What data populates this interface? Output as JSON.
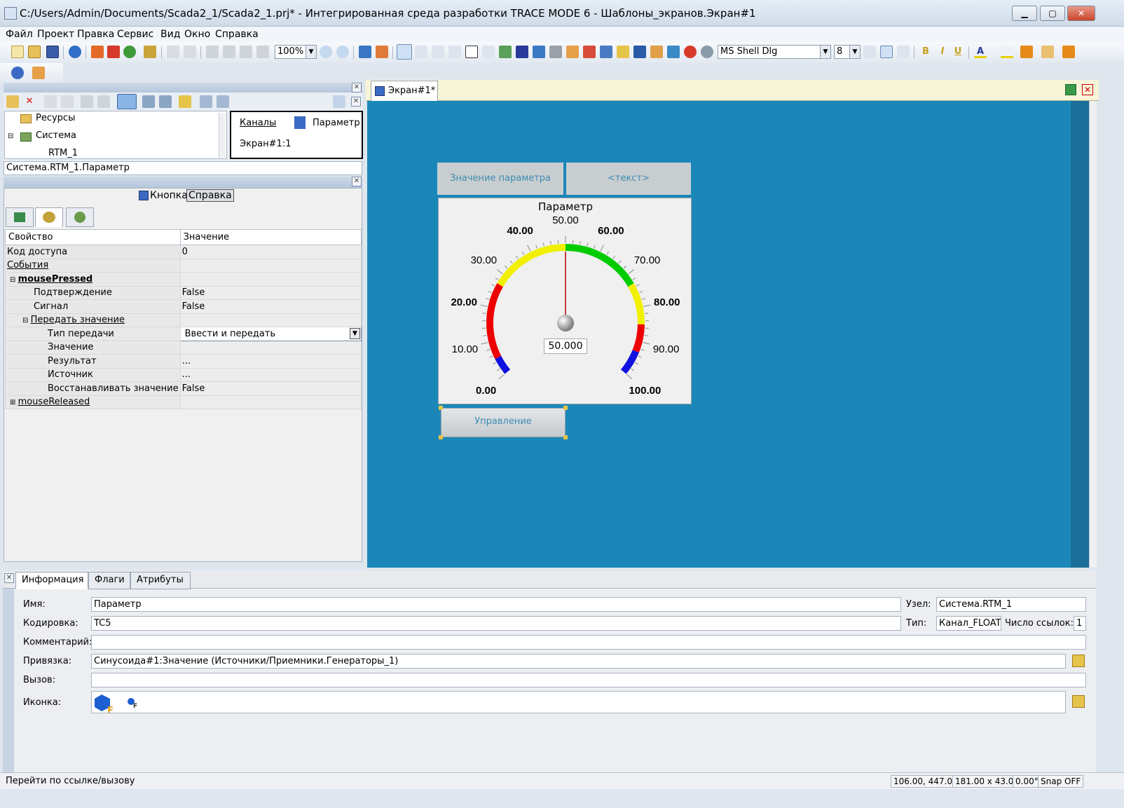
{
  "window": {
    "title": "C:/Users/Admin/Documents/Scada2_1/Scada2_1.prj* - Интегрированная среда разработки TRACE MODE 6 - Шаблоны_экранов.Экран#1",
    "min": "▁",
    "max": "▢",
    "close": "✕"
  },
  "menu": [
    "Файл",
    "Проект",
    "Правка",
    "Сервис",
    "Вид",
    "Окно",
    "Справка"
  ],
  "toolbar": {
    "zoom": "100%",
    "font_name": "MS Shell Dlg",
    "font_size": "8",
    "bold": "B",
    "italic": "I",
    "underline": "U",
    "text_color": "A"
  },
  "tree": {
    "items": [
      "Ресурсы",
      "Система",
      "RTM_1"
    ]
  },
  "channels": {
    "link": "Каналы",
    "param": "Параметр",
    "screen": "Экран#1:1"
  },
  "path": "Система.RTM_1.Параметр",
  "props": {
    "component_label": "Кнопка",
    "help_button": "Справка",
    "col_property": "Свойство",
    "col_value": "Значение",
    "rows": [
      {
        "k": "Код доступа",
        "v": "0"
      },
      {
        "k": "События",
        "v": ""
      },
      {
        "k": "mousePressed",
        "v": ""
      },
      {
        "k": "Подтверждение",
        "v": "False"
      },
      {
        "k": "Сигнал",
        "v": "False"
      },
      {
        "k": "Передать значение",
        "v": ""
      },
      {
        "k": "Тип передачи",
        "v": "Ввести и передать"
      },
      {
        "k": "Значение",
        "v": ""
      },
      {
        "k": "Результат",
        "v": "..."
      },
      {
        "k": "Источник",
        "v": "..."
      },
      {
        "k": "Восстанавливать значение",
        "v": "False"
      },
      {
        "k": "mouseReleased",
        "v": ""
      }
    ]
  },
  "editor": {
    "tab": "Экран#1*"
  },
  "screen": {
    "btn_param_value": "Значение параметра",
    "btn_text": "<текст>",
    "btn_control": "Управление",
    "gauge": {
      "title": "Параметр",
      "value": "50.000",
      "min": 0,
      "max": 100,
      "current": 50,
      "labels": [
        "0.00",
        "10.00",
        "20.00",
        "30.00",
        "40.00",
        "50.00",
        "60.00",
        "70.00",
        "80.00",
        "90.00",
        "100.00"
      ],
      "colors": {
        "blue": "#1010e0",
        "red": "#ee0000",
        "yellow": "#f0f000",
        "green": "#00cc00"
      }
    }
  },
  "info": {
    "tabs": [
      "Информация",
      "Флаги",
      "Атрибуты"
    ],
    "name_label": "Имя:",
    "name": "Параметр",
    "node_label": "Узел:",
    "node": "Система.RTM_1",
    "enc_label": "Кодировка:",
    "enc": "TC5",
    "type_label": "Тип:",
    "type": "Канал_FLOAT",
    "refs_label": "Число ссылок:",
    "refs": "1",
    "comment_label": "Комментарий:",
    "comment": "",
    "binding_label": "Привязка:",
    "binding": "Синусоида#1:Значение (Источники/Приемники.Генераторы_1)",
    "call_label": "Вызов:",
    "call": "",
    "icon_label": "Иконка:"
  },
  "status": {
    "hint": "Перейти по ссылке/вызову",
    "coords": "106.00, 447.00",
    "size": "181.00 x 43.00",
    "angle": "0.00°",
    "snap": "Snap OFF"
  },
  "accent": "#1b87b8"
}
